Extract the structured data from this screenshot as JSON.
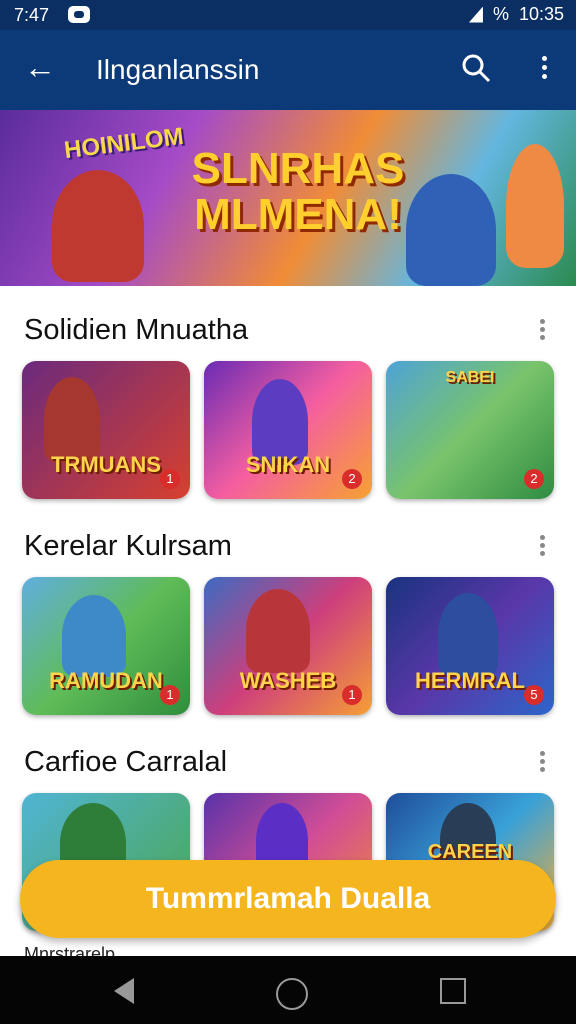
{
  "status_bar": {
    "time": "7:47",
    "clock": "10:35",
    "battery_label": "%"
  },
  "app_bar": {
    "title": "Ilnganlanssin",
    "back_icon": "arrow-left-icon",
    "search_icon": "search-icon",
    "more_icon": "more-vert-icon"
  },
  "banner": {
    "left_text": "HOINILOM",
    "main_text": "SLNRHAS MLMENA!"
  },
  "sections": [
    {
      "title": "Solidien Mnuatha",
      "cards": [
        {
          "label": "TRMUANS",
          "badge": "1"
        },
        {
          "label": "SNIKAN",
          "badge": "2"
        },
        {
          "label": "SABEI",
          "badge": "2"
        }
      ]
    },
    {
      "title": "Kerelar Kulrsam",
      "cards": [
        {
          "label": "RAMUDAN",
          "badge": "1"
        },
        {
          "label": "WASHEB",
          "badge": "1"
        },
        {
          "label": "HERMRAL",
          "badge": "5"
        }
      ]
    },
    {
      "title": "Carfioe Carralal",
      "cards": [
        {
          "label": "",
          "badge": ""
        },
        {
          "label": "",
          "badge": ""
        },
        {
          "label": "CAREEN",
          "badge": ""
        }
      ]
    }
  ],
  "cta": {
    "label": "Tummrlamah Dualla"
  },
  "partial_next_section": "Mnrstrarelp",
  "colors": {
    "app_bar": "#0c3a78",
    "cta": "#f5b51e"
  }
}
